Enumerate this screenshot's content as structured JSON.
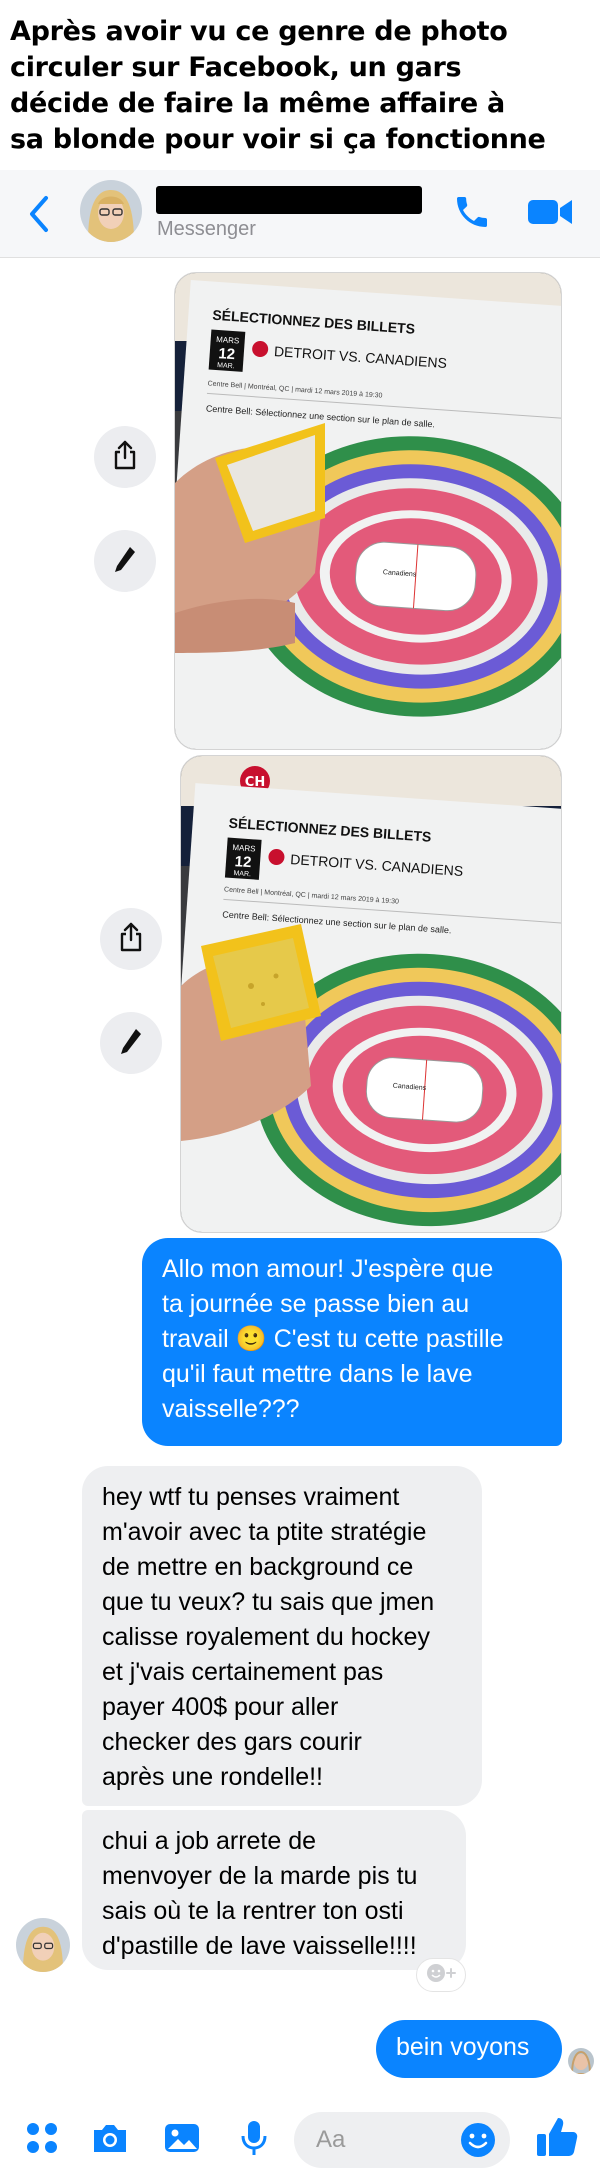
{
  "caption": {
    "line1": "Après avoir vu ce genre de photo",
    "line2": "circuler sur Facebook, un gars",
    "line3": "décide de faire la même affaire à",
    "line4": "sa blonde pour voir si ça fonctionne"
  },
  "header": {
    "subtitle": "Messenger",
    "contact_name_redacted": true,
    "icons": [
      "back-chevron-icon",
      "phone-icon",
      "video-camera-icon"
    ],
    "accent_color": "#0a84ff"
  },
  "photos": [
    {
      "page_heading": "SÉLECTIONNEZ DES BILLETS",
      "date_month": "MARS",
      "date_day": "12",
      "date_sub": "MAR.",
      "matchup": "DETROIT VS. CANADIENS",
      "venue": "Centre Bell  |  Montréal, QC  |  mardi 12 mars 2019 à 19:30",
      "instruction": "Centre Bell: Sélectionnez une section sur le plan de salle.",
      "rink_text": "Canadiens"
    },
    {
      "page_heading": "SÉLECTIONNEZ DES BILLETS",
      "date_month": "MARS",
      "date_day": "12",
      "date_sub": "MAR.",
      "matchup": "DETROIT VS. CANADIENS",
      "venue": "Centre Bell  |  Montréal, QC  |  mardi 12 mars 2019 à 19:30",
      "instruction": "Centre Bell: Sélectionnez une section sur le plan de salle.",
      "rink_text": "Canadiens"
    }
  ],
  "messages": [
    {
      "direction": "outgoing",
      "text": "Allo mon amour! J'espère que\nta journée se passe bien au\ntravail 🙂 C'est tu cette pastille\nqu'il faut mettre dans le lave\nvaisselle???"
    },
    {
      "direction": "incoming",
      "text": "hey wtf tu penses vraiment\nm'avoir avec ta ptite stratégie\nde mettre en background ce\nque tu veux? tu sais que jmen\ncalisse royalement du hockey\net j'vais certainement pas\npayer 400$ pour aller\nchecker des gars courir\naprès une rondelle!!"
    },
    {
      "direction": "incoming",
      "text": "chui a job arrete de\nmenvoyer de la marde pis tu\nsais où te la rentrer ton osti\nd'pastille de lave vaisselle!!!!"
    },
    {
      "direction": "outgoing",
      "text": "bein voyons"
    }
  ],
  "composer": {
    "placeholder": "Aa",
    "icons": [
      "apps-grid-icon",
      "camera-icon",
      "gallery-icon",
      "microphone-icon",
      "emoji-icon",
      "thumbs-up-icon"
    ]
  },
  "colors": {
    "outgoing_bubble": "#0a84ff",
    "incoming_bubble": "#eeeff1",
    "pastille_yellow": "#f2c21b",
    "canadiens_red": "#c8102e"
  }
}
